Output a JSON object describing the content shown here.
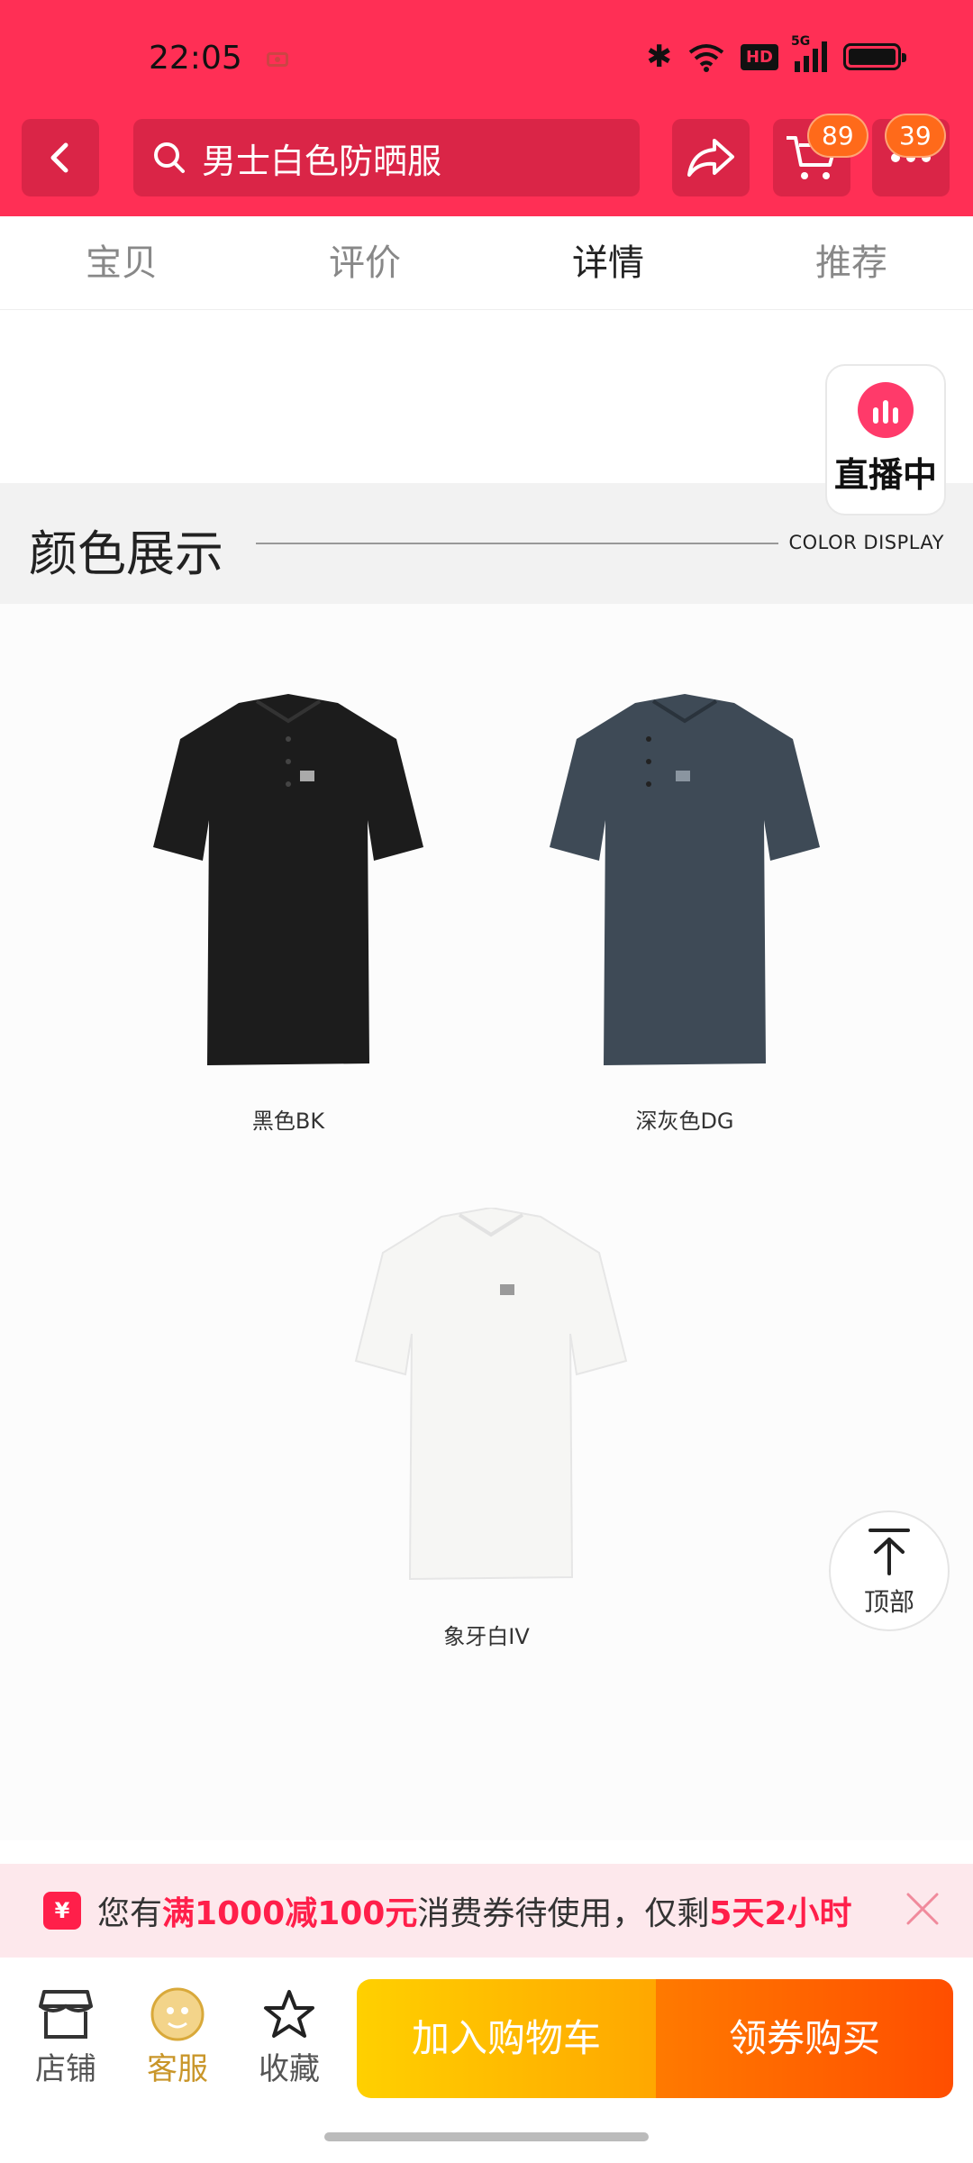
{
  "status_bar": {
    "time": "22:05",
    "hd": "HD",
    "network": "5G"
  },
  "header": {
    "search_query": "男士白色防晒服",
    "cart_badge": "89",
    "more_badge": "39"
  },
  "tabs": [
    {
      "label": "宝贝"
    },
    {
      "label": "评价"
    },
    {
      "label": "详情"
    },
    {
      "label": "推荐"
    }
  ],
  "live": {
    "label": "直播中"
  },
  "section": {
    "title": "颜色展示",
    "subtitle": "COLOR DISPLAY"
  },
  "colors": [
    {
      "name": "黑色BK",
      "color": "#1c1c1c"
    },
    {
      "name": "深灰色DG",
      "color": "#3e4a56"
    },
    {
      "name": "象牙白IV",
      "color": "#f8f8f6"
    }
  ],
  "to_top": {
    "label": "顶部"
  },
  "coupon": {
    "icon": "¥",
    "prefix": "您有",
    "amount": "满1000减100元",
    "middle": "消费券待使用，仅剩",
    "remaining": "5天2小时"
  },
  "bottom_bar": {
    "store": "店铺",
    "service": "客服",
    "favorite": "收藏",
    "add_to_cart": "加入购物车",
    "coupon_buy": "领券购买"
  },
  "theme": {
    "accent": "#ff2f55"
  }
}
